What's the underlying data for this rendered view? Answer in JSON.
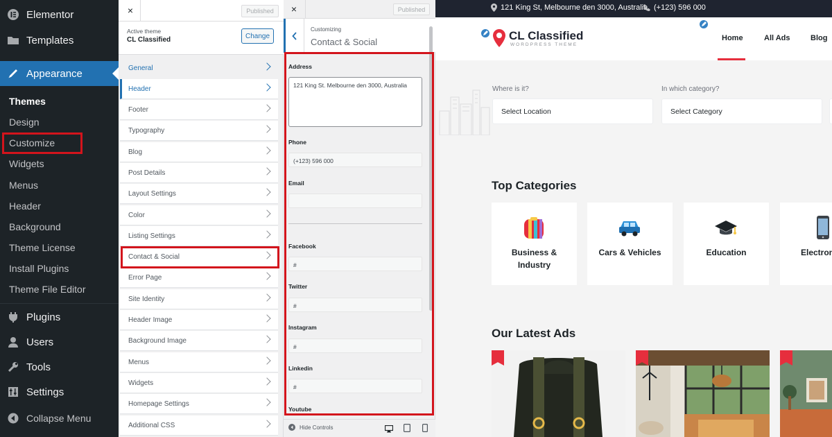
{
  "wp_menu": {
    "elementor": "Elementor",
    "templates": "Templates",
    "appearance": "Appearance",
    "submenu": [
      "Themes",
      "Design",
      "Customize",
      "Widgets",
      "Menus",
      "Header",
      "Background",
      "Theme License",
      "Install Plugins",
      "Theme File Editor"
    ],
    "plugins": "Plugins",
    "users": "Users",
    "tools": "Tools",
    "settings": "Settings",
    "collapse": "Collapse Menu"
  },
  "customizer": {
    "close": "×",
    "published": "Published",
    "active_theme_label": "Active theme",
    "active_theme_name": "CL Classified",
    "change_label": "Change",
    "sections": [
      "General",
      "Header",
      "Footer",
      "Typography",
      "Blog",
      "Post Details",
      "Layout Settings",
      "Color",
      "Listing Settings",
      "Contact & Social",
      "Error Page",
      "Site Identity",
      "Header Image",
      "Background Image",
      "Menus",
      "Widgets",
      "Homepage Settings",
      "Additional CSS"
    ]
  },
  "contact_panel": {
    "close": "×",
    "published": "Published",
    "customizing": "Customizing",
    "title": "Contact & Social",
    "address_label": "Address",
    "address_value": "121 King St. Melbourne den 3000, Australia",
    "phone_label": "Phone",
    "phone_value": "(+123) 596 000",
    "email_label": "Email",
    "email_value": "",
    "facebook_label": "Facebook",
    "facebook_value": "#",
    "twitter_label": "Twitter",
    "twitter_value": "#",
    "instagram_label": "Instagram",
    "instagram_value": "#",
    "linkedin_label": "Linkedin",
    "linkedin_value": "#",
    "youtube_label": "Youtube",
    "hide_controls": "Hide Controls"
  },
  "preview": {
    "top_address": "121 King St, Melbourne den 3000, Australia",
    "top_phone": "(+123) 596 000",
    "logo_name": "CL Classified",
    "logo_tagline": "WORDPRESS THEME",
    "nav": [
      "Home",
      "All Ads",
      "Blog"
    ],
    "where_label": "Where is it?",
    "where_placeholder": "Select Location",
    "category_label": "In which category?",
    "category_placeholder": "Select Category",
    "top_categories_heading": "Top Categories",
    "categories": [
      {
        "line1": "Business &",
        "line2": "Industry"
      },
      {
        "line1": "Cars & Vehicles",
        "line2": ""
      },
      {
        "line1": "Education",
        "line2": ""
      },
      {
        "line1": "Electron",
        "line2": ""
      }
    ],
    "latest_ads_heading": "Our Latest Ads"
  },
  "colors": {
    "wp_dark": "#1d2327",
    "wp_blue": "#2271b1",
    "highlight_red": "#d3141c",
    "brand_red": "#e62e3d",
    "topbar_dark": "#1f2430"
  }
}
